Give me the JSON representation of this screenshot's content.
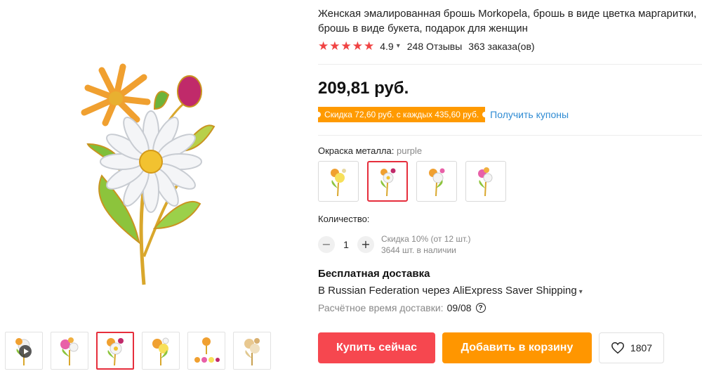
{
  "product": {
    "title": "Женская эмалированная брошь Morkopela, брошь в виде цветка маргаритки, брошь в виде букета, подарок для женщин",
    "rating": "4.9",
    "reviews": "248 Отзывы",
    "orders": "363 заказа(ов)",
    "price": "209,81 руб.",
    "coupon_text": "Скидка 72,60 руб. с каждых 435,60 руб.",
    "coupon_link": "Получить купоны"
  },
  "gallery": {
    "thumbnails": [
      "video",
      "pink bouquet",
      "purple bouquet",
      "yellow bouquet",
      "set",
      "gold bouquet"
    ],
    "active_index": 2
  },
  "variant": {
    "label": "Окраска металла:",
    "selected": "purple",
    "options_count": 4,
    "active_index": 1
  },
  "quantity": {
    "label": "Количество:",
    "value": "1",
    "minus_icon": "minus-icon",
    "plus_icon": "plus-icon",
    "bulk_discount": "Скидка 10% (от 12 шт.)",
    "stock": "3644 шт. в наличии"
  },
  "shipping": {
    "title": "Бесплатная доставка",
    "route": "В Russian Federation через AliExpress Saver Shipping",
    "eta_label": "Расчётное время доставки:",
    "eta_value": "09/08"
  },
  "actions": {
    "buy_now": "Купить сейчас",
    "add_to_cart": "Добавить в корзину",
    "wishlist_count": "1807"
  },
  "colors": {
    "star": "#f04343",
    "buy": "#f6474f",
    "cart": "#ff9600",
    "coupon": "#ff9a00",
    "link": "#2f8bd3",
    "active_border": "#e62e3c"
  }
}
